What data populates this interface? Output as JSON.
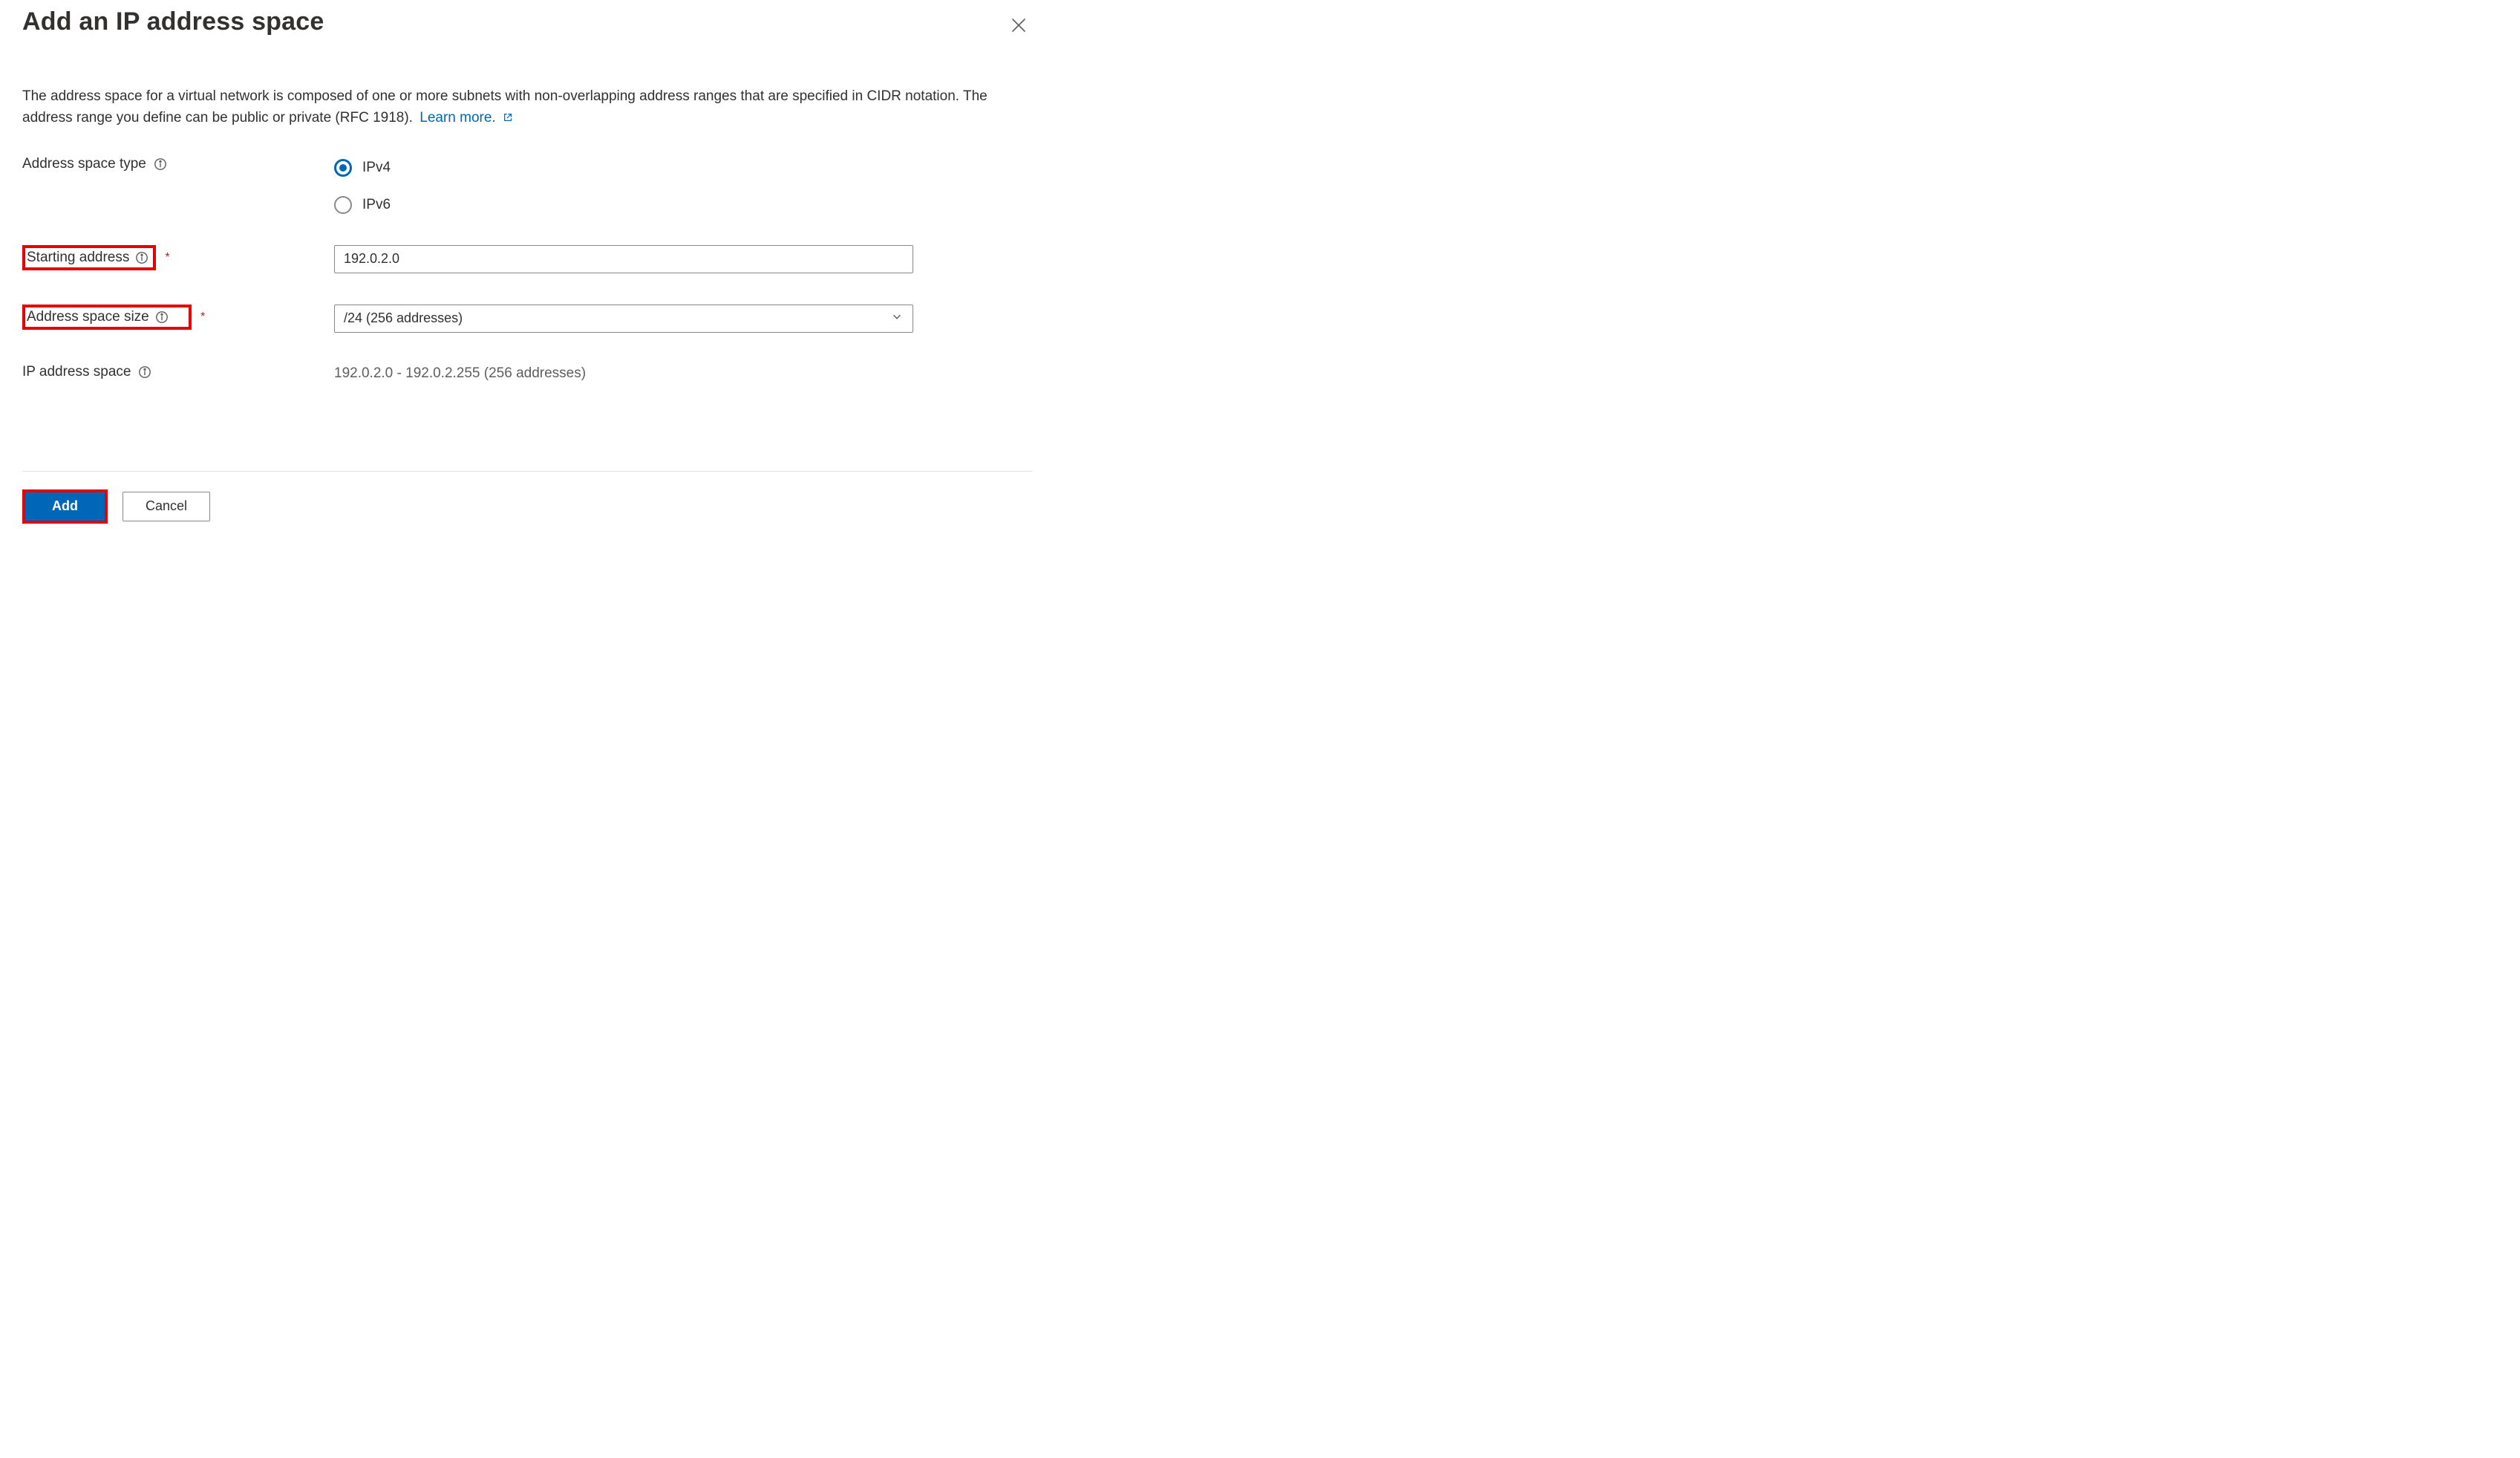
{
  "header": {
    "title": "Add an IP address space"
  },
  "description": {
    "text": "The address space for a virtual network is composed of one or more subnets with non-overlapping address ranges that are specified in CIDR notation. The address range you define can be public or private (RFC 1918).",
    "learn_more": "Learn more."
  },
  "form": {
    "address_space_type": {
      "label": "Address space type",
      "options": {
        "ipv4": "IPv4",
        "ipv6": "IPv6"
      },
      "selected": "ipv4"
    },
    "starting_address": {
      "label": "Starting address",
      "required": true,
      "value": "192.0.2.0"
    },
    "address_space_size": {
      "label": "Address space size",
      "required": true,
      "value": "/24 (256 addresses)"
    },
    "ip_address_space": {
      "label": "IP address space",
      "computed": "192.0.2.0 - 192.0.2.255 (256 addresses)"
    }
  },
  "footer": {
    "primary": "Add",
    "secondary": "Cancel"
  }
}
